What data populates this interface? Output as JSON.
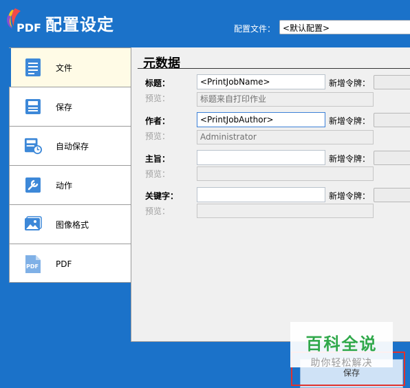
{
  "header": {
    "logo_text": "PDF",
    "title": "配置设定",
    "profile_label": "配置文件：",
    "profile_value": "<默认配置>"
  },
  "sidebar": {
    "items": [
      {
        "label": "文件",
        "icon": "document-icon",
        "active": true
      },
      {
        "label": "保存",
        "icon": "save-icon",
        "active": false
      },
      {
        "label": "自动保存",
        "icon": "autosave-icon",
        "active": false
      },
      {
        "label": "动作",
        "icon": "wrench-icon",
        "active": false
      },
      {
        "label": "图像格式",
        "icon": "image-icon",
        "active": false
      },
      {
        "label": "PDF",
        "icon": "pdf-icon",
        "active": false
      }
    ]
  },
  "metadata": {
    "title": "元数据",
    "preview_label": "预览：",
    "token_label": "新增令牌：",
    "fields": {
      "title": {
        "label": "标题：",
        "value": "<PrintJobName>",
        "preview": "标题来自打印作业"
      },
      "author": {
        "label": "作者：",
        "value": "<PrintJobAuthor>",
        "preview": "Administrator"
      },
      "subject": {
        "label": "主旨：",
        "value": "",
        "preview": ""
      },
      "keywords": {
        "label": "关键字：",
        "value": "",
        "preview": ""
      }
    }
  },
  "footer": {
    "save_label": "保存"
  },
  "watermark": {
    "main": "百科全说",
    "sub": "助你轻松解决"
  },
  "colors": {
    "header_bg": "#1b72c9",
    "active_item_bg": "#fffbe6",
    "icon_blue": "#3d88d8",
    "highlight_red": "#e0322d",
    "watermark_green": "#2fa84a"
  }
}
